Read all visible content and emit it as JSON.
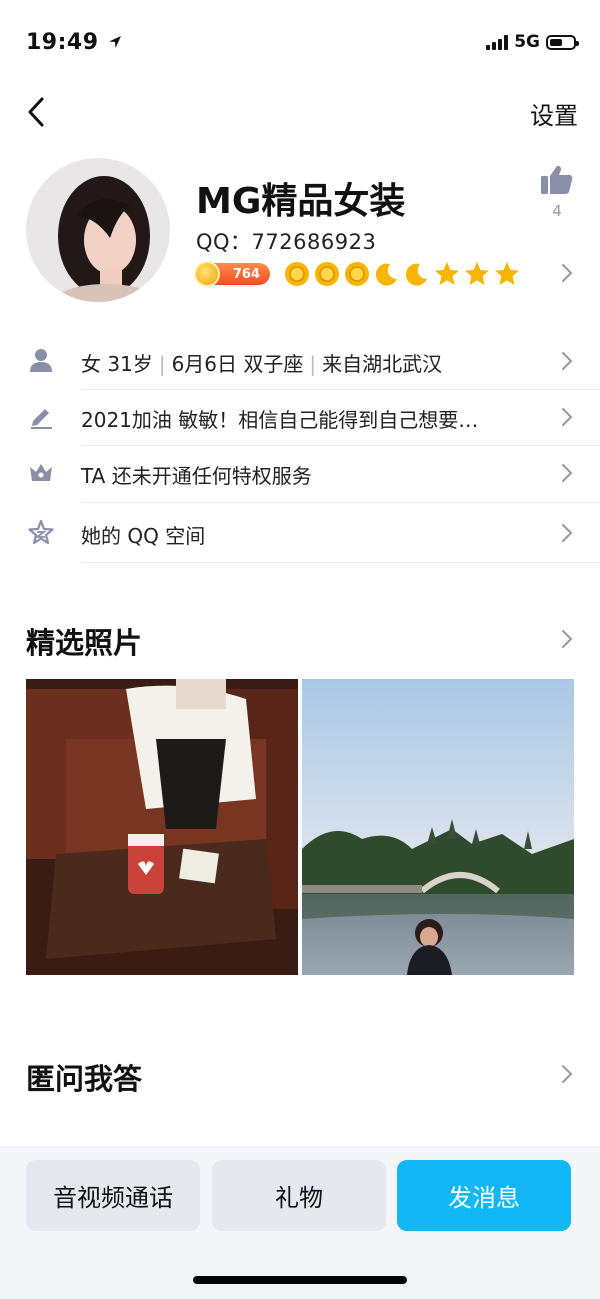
{
  "status_bar": {
    "time": "19:49",
    "network": "5G"
  },
  "nav": {
    "settings_label": "设置"
  },
  "profile": {
    "name": "MG精品女装",
    "qq": "QQ：772686923",
    "likes": "4",
    "vip_value": "764"
  },
  "info_rows": [
    {
      "icon": "person-icon",
      "parts": [
        "女 31岁",
        "6月6日 双子座",
        "来自湖北武汉"
      ]
    },
    {
      "icon": "pencil-icon",
      "text": "2021加油 敏敏！相信自己能得到自己想要…"
    },
    {
      "icon": "crown-icon",
      "text": "TA 还未开通任何特权服务"
    },
    {
      "icon": "star-icon",
      "text": "她的 QQ 空间"
    }
  ],
  "sections": {
    "photos_title": "精选照片",
    "qa_title": "匿问我答"
  },
  "bottom_bar": {
    "call_label": "音视频通话",
    "gift_label": "礼物",
    "message_label": "发消息"
  },
  "colors": {
    "accent": "#12b7f5",
    "vip_orange": "#f04f23",
    "icon_gray": "#8a8fa8"
  }
}
